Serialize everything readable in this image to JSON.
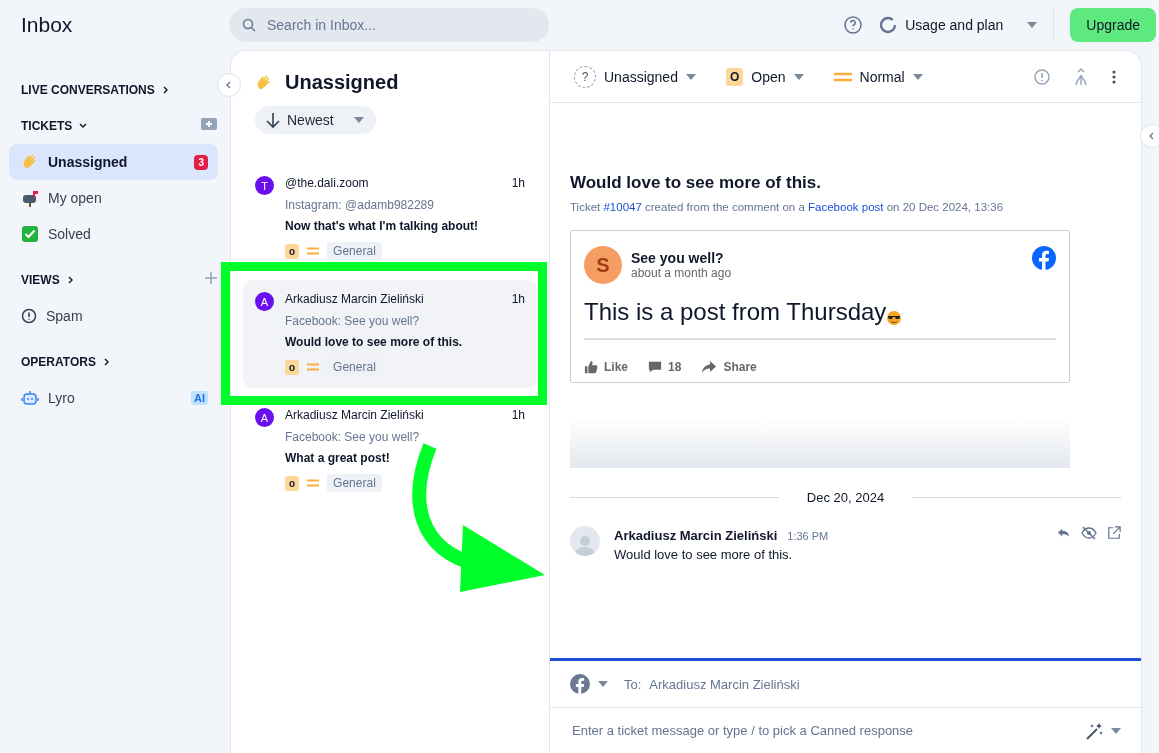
{
  "app": {
    "title": "Inbox"
  },
  "search": {
    "placeholder": "Search in Inbox..."
  },
  "header": {
    "usage": "Usage and plan",
    "upgrade": "Upgrade"
  },
  "sidebar": [
    {
      "kind": "heading",
      "label": "LIVE CONVERSATIONS",
      "expanded": false
    },
    {
      "kind": "heading",
      "label": "TICKETS",
      "expanded": true
    },
    {
      "kind": "item",
      "label": "Unassigned",
      "badge": "3",
      "selected": true
    },
    {
      "kind": "item",
      "label": "My open",
      "selected": false
    },
    {
      "kind": "item",
      "label": "Solved",
      "selected": false
    },
    {
      "kind": "heading",
      "label": "VIEWS",
      "expanded": false
    },
    {
      "kind": "item",
      "label": "Spam",
      "selected": false
    },
    {
      "kind": "heading",
      "label": "OPERATORS",
      "expanded": false
    },
    {
      "kind": "item",
      "label": "Lyro",
      "tag": "AI",
      "selected": false
    }
  ],
  "list": {
    "title": "Unassigned",
    "sort": "Newest",
    "tickets": [
      {
        "avatar": "T",
        "color": "#6a0ff0",
        "name": "@the.dali.zoom",
        "time": "1h",
        "source": "Instagram: @adamb982289",
        "message": "Now that's what I'm talking about!",
        "status": "o",
        "tag": "General",
        "selected": false
      },
      {
        "avatar": "A",
        "color": "#6a0ff0",
        "name": "Arkadiusz Marcin Zieliński",
        "time": "1h",
        "source": "Facebook: See you well?",
        "message": "Would love to see more of this.",
        "status": "o",
        "tag": "General",
        "selected": true
      },
      {
        "avatar": "A",
        "color": "#6a0ff0",
        "name": "Arkadiusz Marcin Zieliński",
        "time": "1h",
        "source": "Facebook: See you well?",
        "message": "What a great post!",
        "status": "o",
        "tag": "General",
        "selected": false
      }
    ]
  },
  "ticket": {
    "toolbar": {
      "assignee": "Unassigned",
      "assignee_mark": "?",
      "status_badge": "O",
      "status": "Open",
      "priority": "Normal"
    },
    "title": "Would love to see more of this.",
    "meta": [
      {
        "text": "Ticket "
      },
      {
        "text": "#10047",
        "link": true
      },
      {
        "text": " created from the comment on a "
      },
      {
        "text": "Facebook post",
        "link": true
      },
      {
        "text": " on 20 Dec 2024, 13:36"
      }
    ],
    "post": {
      "avatar": "S",
      "author": "See you well?",
      "time": "about a month ago",
      "body": "This is a post from Thursday",
      "like": "Like",
      "comments": "18",
      "share": "Share"
    },
    "date": "Dec 20, 2024",
    "message": {
      "author": "Arkadiusz Marcin Zieliński",
      "time": "1:36 PM",
      "text": "Would love to see more of this."
    },
    "composer": {
      "to_label": "To:",
      "recipient": "Arkadiusz Marcin Zieliński",
      "placeholder": "Enter a ticket message or type / to pick a Canned response"
    }
  }
}
